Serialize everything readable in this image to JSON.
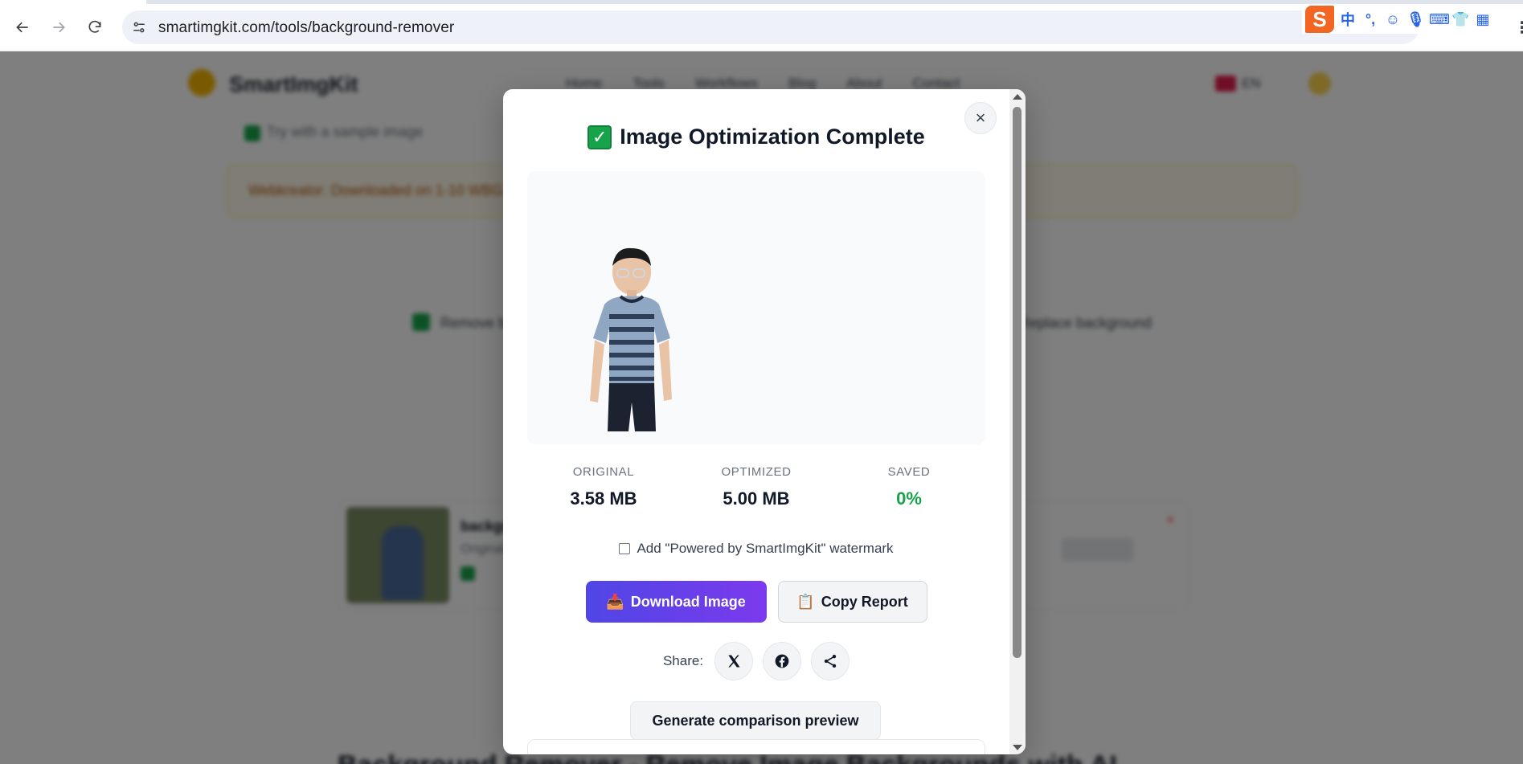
{
  "browser": {
    "url": "smartimgkit.com/tools/background-remover",
    "ime": {
      "logo": "S",
      "items": [
        "中",
        "°,",
        "☺",
        "🎙",
        "⌨",
        "👕",
        "▦"
      ]
    },
    "menu_glyph": "⋮"
  },
  "background_page": {
    "logo_text": "SmartImgKit",
    "nav": [
      "Home",
      "Tools",
      "Workflows",
      "Blog",
      "About",
      "Contact"
    ],
    "lang": "EN",
    "sample_link": "Try with a sample image",
    "warning": "Webkreator: Downloaded on 1-10 WBG Files...",
    "feature_left": "Remove background",
    "feature_right": "Replace background",
    "result": {
      "name": "background-removed.png",
      "meta": "Original 3.58 MB",
      "download": "Download"
    },
    "bottom_heading": "Background Remover - Remove Image Backgrounds with AI"
  },
  "modal": {
    "title_emoji": "✓",
    "title": "Image Optimization Complete",
    "close": "×",
    "stats": [
      {
        "label": "ORIGINAL",
        "value": "3.58 MB"
      },
      {
        "label": "OPTIMIZED",
        "value": "5.00 MB"
      },
      {
        "label": "SAVED",
        "value": "0%"
      }
    ],
    "watermark_label": "Add \"Powered by SmartImgKit\" watermark",
    "watermark_checked": false,
    "download_label": "Download Image",
    "download_icon": "📥",
    "copy_label": "Copy Report",
    "copy_icon": "📋",
    "share_label": "Share:",
    "compare_label": "Generate comparison preview"
  },
  "colors": {
    "accent_start": "#4f46e5",
    "accent_end": "#7c3aed",
    "saved_green": "#16a34a"
  }
}
